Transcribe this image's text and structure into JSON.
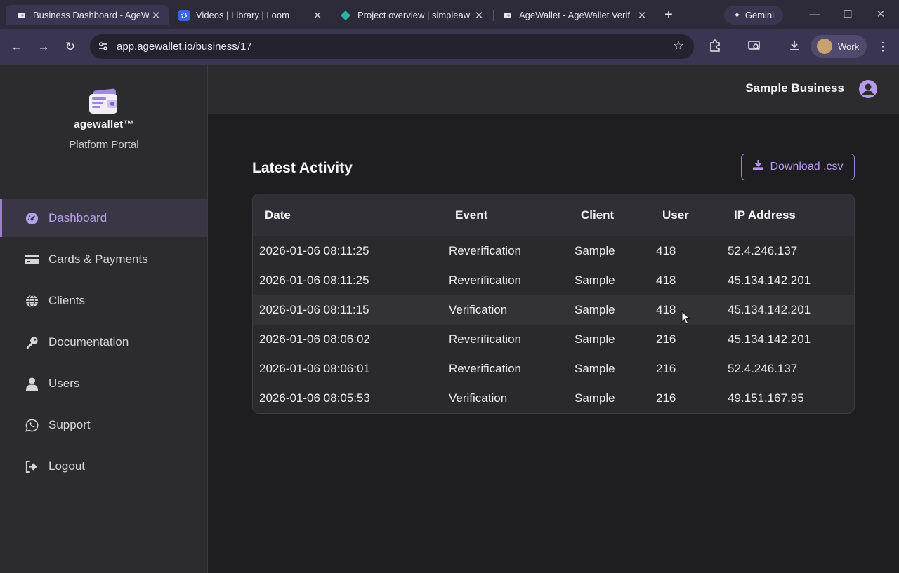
{
  "browser": {
    "tabs": [
      {
        "title": "Business Dashboard - AgeW",
        "active": true,
        "icon": "agewallet-favicon"
      },
      {
        "title": "Videos | Library | Loom",
        "active": false,
        "icon": "loom-favicon"
      },
      {
        "title": "Project overview | simpleaw",
        "active": false,
        "icon": "diamond-favicon"
      },
      {
        "title": "AgeWallet - AgeWallet Verif",
        "active": false,
        "icon": "agewallet-favicon"
      }
    ],
    "gemini_label": "Gemini",
    "url": "app.agewallet.io/business/17",
    "profile_label": "Work"
  },
  "sidebar": {
    "wordmark": "agewallet™",
    "portal_label": "Platform Portal",
    "items": [
      {
        "label": "Dashboard",
        "icon": "dashboard-gauge-icon",
        "active": true
      },
      {
        "label": "Cards & Payments",
        "icon": "credit-card-icon",
        "active": false
      },
      {
        "label": "Clients",
        "icon": "globe-icon",
        "active": false
      },
      {
        "label": "Documentation",
        "icon": "key-icon",
        "active": false
      },
      {
        "label": "Users",
        "icon": "user-icon",
        "active": false
      },
      {
        "label": "Support",
        "icon": "whatsapp-icon",
        "active": false
      },
      {
        "label": "Logout",
        "icon": "logout-icon",
        "active": false
      }
    ]
  },
  "header": {
    "business_name": "Sample Business"
  },
  "activity": {
    "title": "Latest Activity",
    "download_label": "Download .csv",
    "columns": [
      "Date",
      "Event",
      "Client",
      "User",
      "IP Address"
    ],
    "rows": [
      [
        "2026-01-06 08:11:25",
        "Reverification",
        "Sample",
        "418",
        "52.4.246.137"
      ],
      [
        "2026-01-06 08:11:25",
        "Reverification",
        "Sample",
        "418",
        "45.134.142.201"
      ],
      [
        "2026-01-06 08:11:15",
        "Verification",
        "Sample",
        "418",
        "45.134.142.201"
      ],
      [
        "2026-01-06 08:06:02",
        "Reverification",
        "Sample",
        "216",
        "45.134.142.201"
      ],
      [
        "2026-01-06 08:06:01",
        "Reverification",
        "Sample",
        "216",
        "52.4.246.137"
      ],
      [
        "2026-01-06 08:05:53",
        "Verification",
        "Sample",
        "216",
        "49.151.167.95"
      ]
    ]
  },
  "colors": {
    "accent": "#9b7fd6",
    "sidebar_bg": "#2c2c2e",
    "main_bg": "#1e1d20"
  }
}
